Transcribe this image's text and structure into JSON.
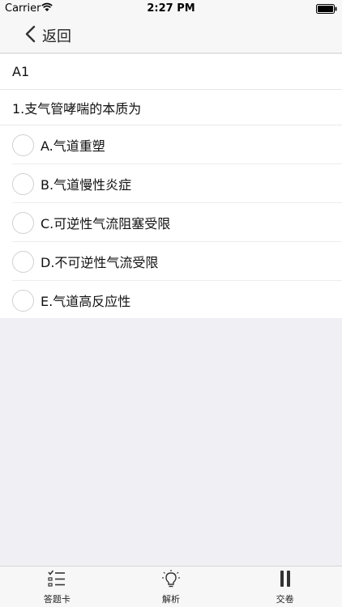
{
  "status_bar": {
    "carrier": "Carrier",
    "time": "2:27 PM",
    "wifi_icon": "wifi-icon",
    "battery_icon": "battery-icon"
  },
  "nav_bar": {
    "back_label": "返回",
    "back_icon": "chevron-left-icon"
  },
  "content": {
    "section_label": "A1",
    "question": "1.支气管哮喘的本质为",
    "options": [
      {
        "label": "A.气道重塑"
      },
      {
        "label": "B.气道慢性炎症"
      },
      {
        "label": "C.可逆性气流阻塞受限"
      },
      {
        "label": "D.不可逆性气流受限"
      },
      {
        "label": "E.气道高反应性"
      }
    ]
  },
  "tab_bar": {
    "tabs": [
      {
        "label": "答题卡",
        "icon": "list-check-icon"
      },
      {
        "label": "解析",
        "icon": "lightbulb-icon"
      },
      {
        "label": "交卷",
        "icon": "pause-icon"
      }
    ]
  }
}
